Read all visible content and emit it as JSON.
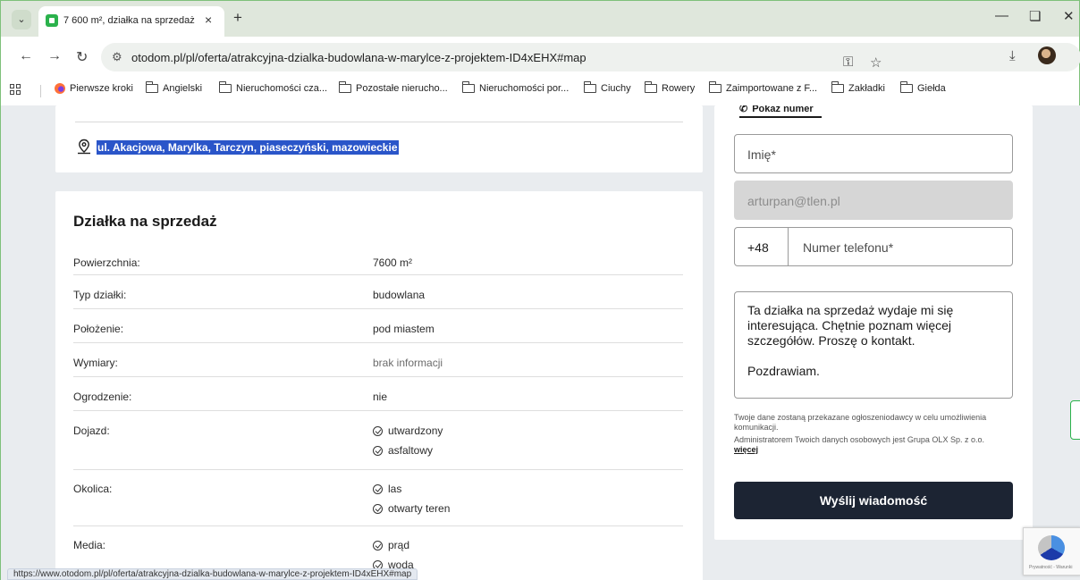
{
  "browser": {
    "tab_title": "7 600 m², działka na sprzedaż -",
    "tab_close": "×",
    "new_tab": "+",
    "url": "otodom.pl/pl/oferta/atrakcyjna-dzialka-budowlana-w-marylce-z-projektem-ID4xEHX#map",
    "status_url": "https://www.otodom.pl/pl/oferta/atrakcyjna-dzialka-budowlana-w-marylce-z-projektem-ID4xEHX#map"
  },
  "bookmarks": [
    {
      "label": "Pierwsze kroki",
      "icon": "firefox-icon"
    },
    {
      "label": "Angielski",
      "icon": "folder-icon"
    },
    {
      "label": "Nieruchomości cza...",
      "icon": "folder-icon"
    },
    {
      "label": "Pozostałe nierucho...",
      "icon": "folder-icon"
    },
    {
      "label": "Nieruchomości por...",
      "icon": "folder-icon"
    },
    {
      "label": "Ciuchy",
      "icon": "folder-icon"
    },
    {
      "label": "Rowery",
      "icon": "folder-icon"
    },
    {
      "label": "Zaimportowane z F...",
      "icon": "folder-icon"
    },
    {
      "label": "Zakładki",
      "icon": "folder-icon"
    },
    {
      "label": "Giełda",
      "icon": "folder-icon"
    }
  ],
  "listing": {
    "address": "ul. Akacjowa, Marylka, Tarczyn, piaseczyński, mazowieckie",
    "details_title": "Działka na sprzedaż",
    "rows": [
      {
        "label": "Powierzchnia:",
        "value": "7600 m²"
      },
      {
        "label": "Typ działki:",
        "value": "budowlana"
      },
      {
        "label": "Położenie:",
        "value": "pod miastem"
      },
      {
        "label": "Wymiary:",
        "value": "brak informacji"
      },
      {
        "label": "Ogrodzenie:",
        "value": "nie"
      },
      {
        "label": "Dojazd:",
        "items": [
          "utwardzony",
          "asfaltowy"
        ]
      },
      {
        "label": "Okolica:",
        "items": [
          "las",
          "otwarty teren"
        ]
      },
      {
        "label": "Media:",
        "items": [
          "prąd",
          "woda"
        ]
      }
    ]
  },
  "contact_form": {
    "show_number": "Pokaż numer",
    "name_placeholder": "Imię*",
    "email_value": "arturpan@tlen.pl",
    "phone_prefix": "+48",
    "phone_placeholder": "Numer telefonu*",
    "message_line1": "Ta działka na sprzedaż wydaje mi się interesująca. Chętnie poznam więcej szczegółów. Proszę o kontakt.",
    "message_line2": "Pozdrawiam.",
    "gdpr_text1": "Twoje dane zostaną przekazane ogłoszeniodawcy w celu umożliwienia komunikacji.",
    "gdpr_text2": "Administratorem Twoich danych osobowych jest Grupa OLX Sp. z o.o.",
    "gdpr_more": "więcej",
    "send_label": "Wyślij wiadomość"
  },
  "recaptcha": {
    "links": "Prywatność - Warunki"
  }
}
